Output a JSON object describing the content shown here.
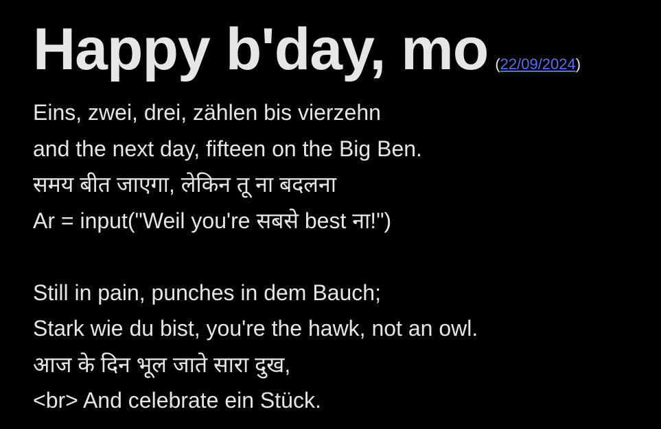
{
  "title": "Happy b'day, mo",
  "date": {
    "open": "(",
    "link": "22/09/2024",
    "close": ")"
  },
  "stanza1": [
    "Eins, zwei, drei, zählen bis vierzehn",
    "and the next day, fifteen on the Big Ben.",
    "समय बीत जाएगा, लेकिन तू ना बदलना",
    "Ar = input(\"Weil you're सबसे best ना!\")"
  ],
  "stanza2": [
    "Still in pain, punches in dem Bauch;",
    "Stark wie du bist, you're the hawk, not an owl.",
    "आज के दिन भूल जाते सारा दुख,",
    "<br> And celebrate ein Stück."
  ],
  "colors": {
    "background": "#000000",
    "text": "#e6e6e6",
    "link": "#5a6cf0"
  }
}
